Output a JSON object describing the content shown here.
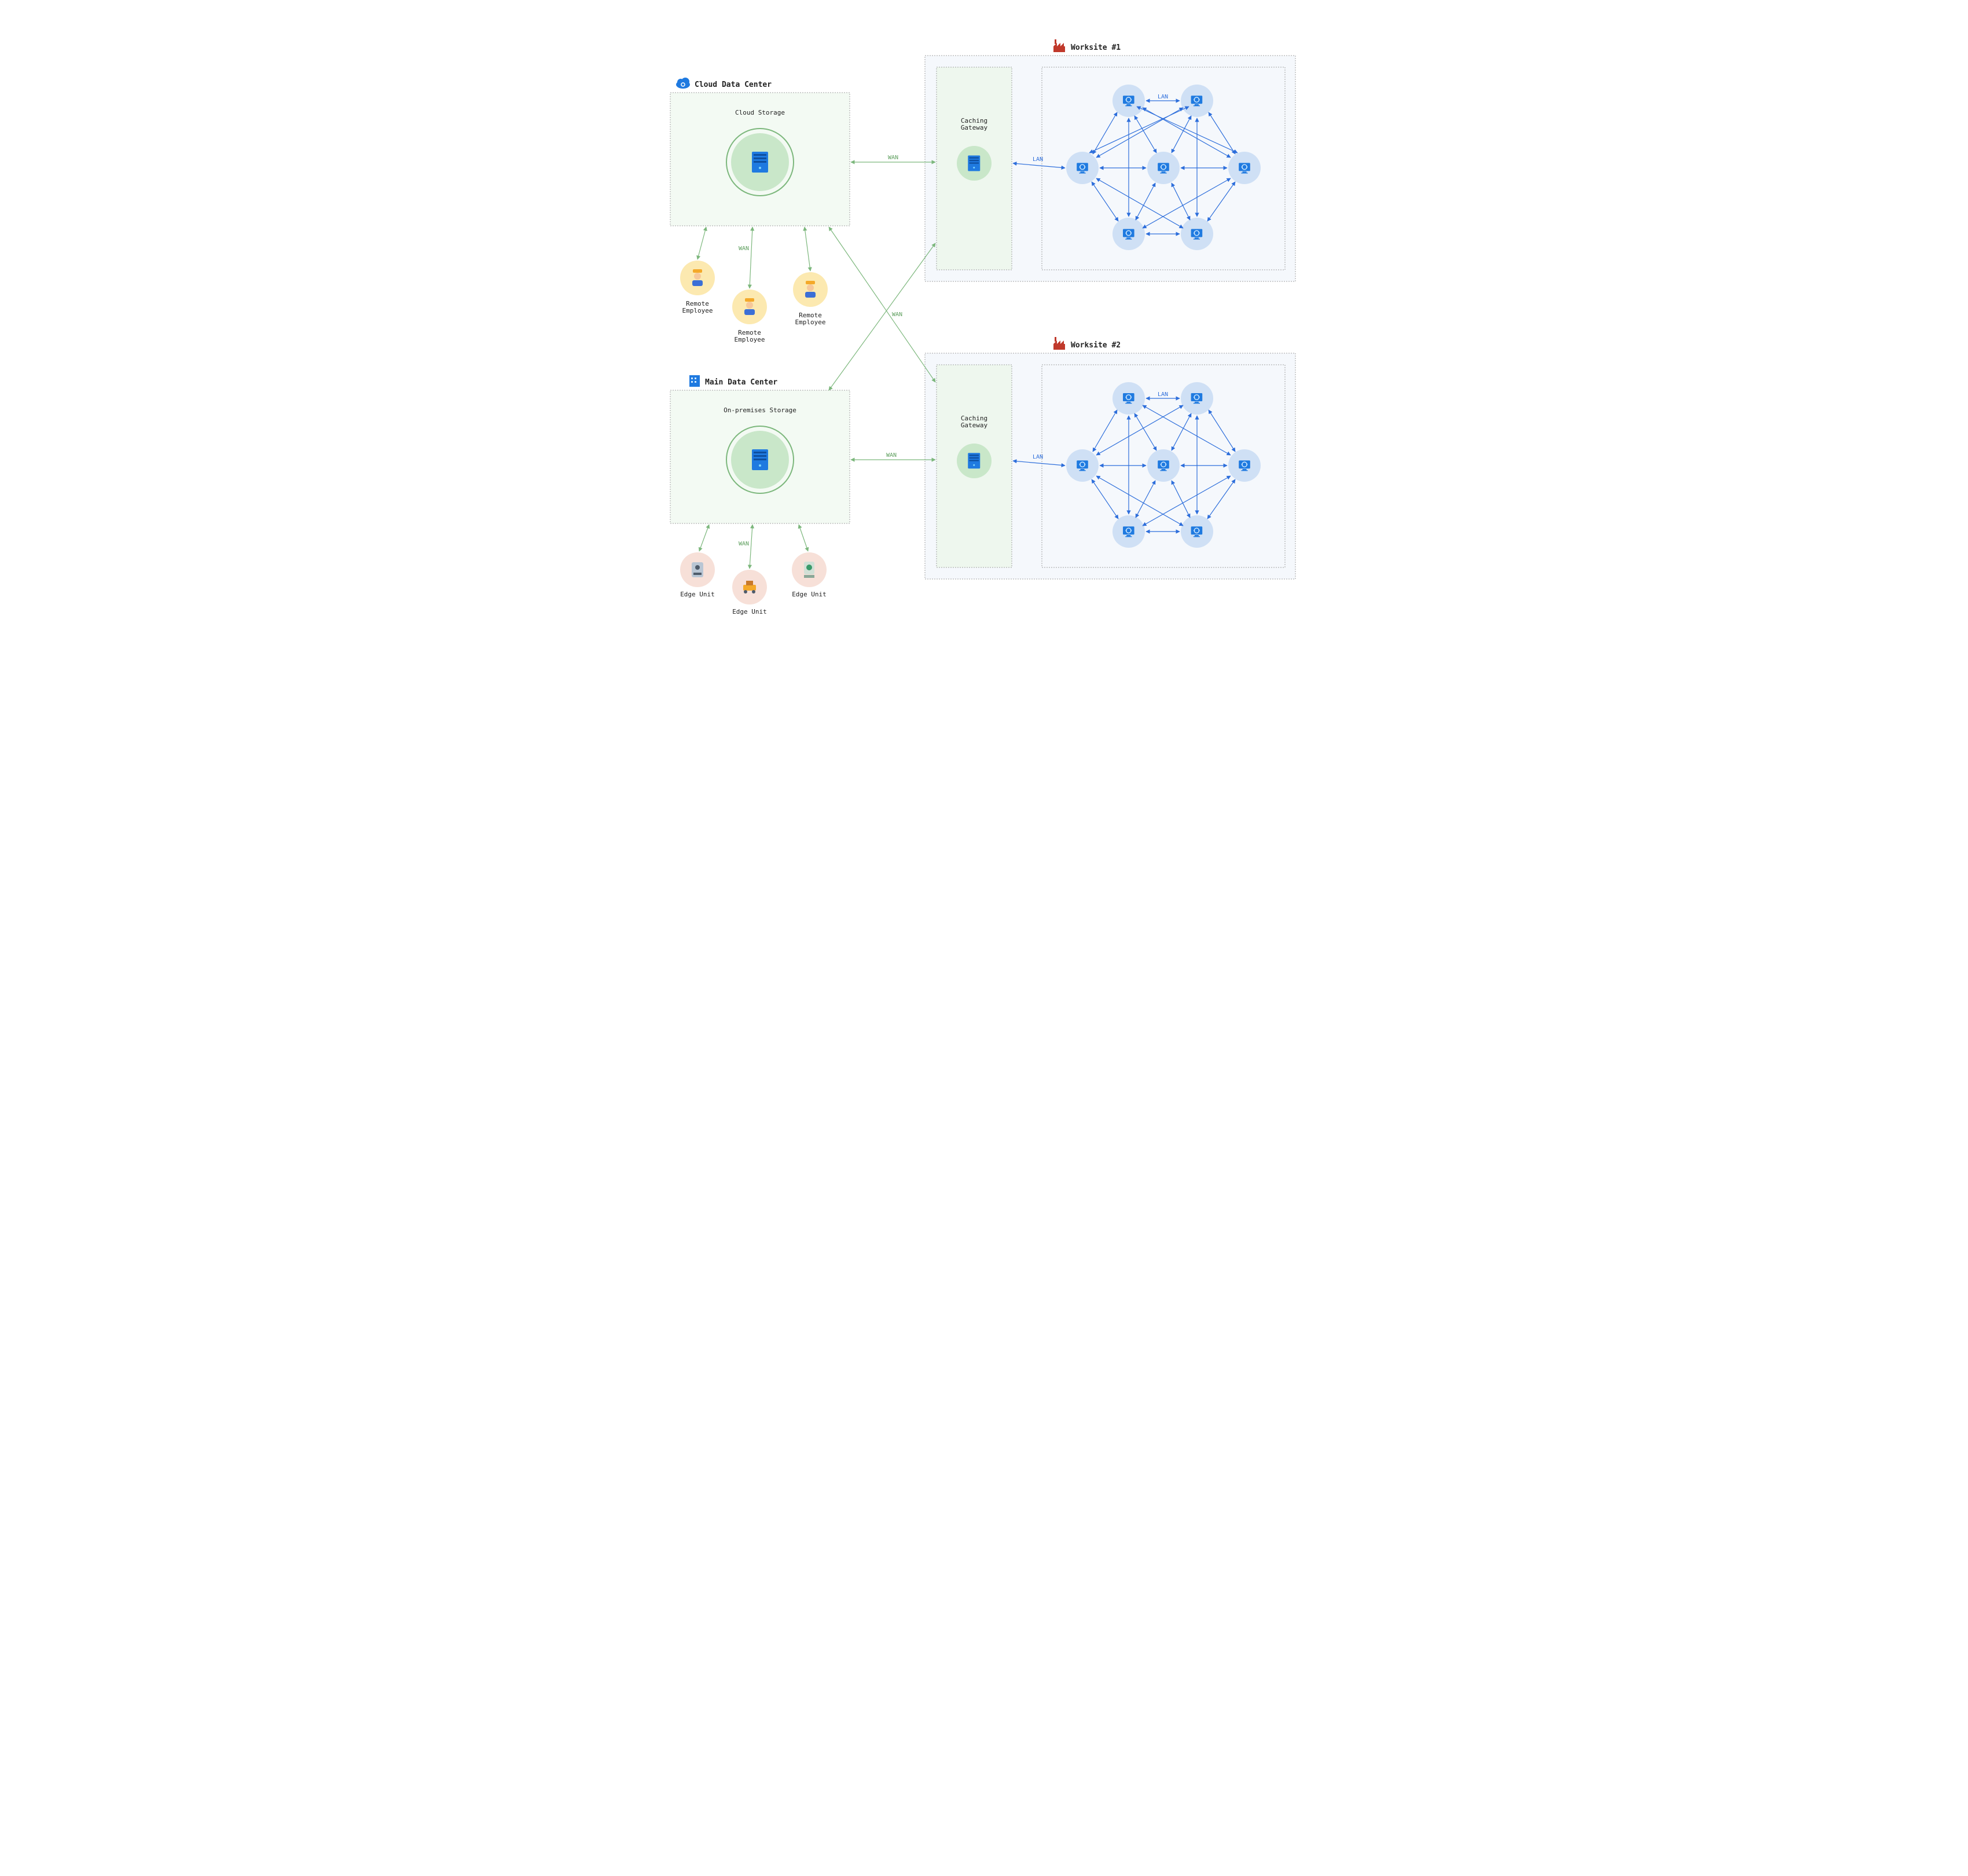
{
  "cloud": {
    "title": "Cloud Data Center",
    "storage_label": "Cloud Storage"
  },
  "main": {
    "title": "Main Data Center",
    "storage_label": "On-premises Storage"
  },
  "employees": [
    "Remote\nEmployee",
    "Remote\nEmployee",
    "Remote\nEmployee"
  ],
  "edge_units": [
    "Edge Unit",
    "Edge Unit",
    "Edge Unit"
  ],
  "worksite1": {
    "title": "Worksite #1",
    "gateway_label": "Caching\nGateway",
    "lan_inner": "LAN"
  },
  "worksite2": {
    "title": "Worksite #2",
    "gateway_label": "Caching\nGateway",
    "lan_inner": "LAN"
  },
  "links": {
    "wan": "WAN",
    "lan": "LAN"
  },
  "colors": {
    "green": "#7cb77c",
    "blue": "#2d6edb",
    "yellow": "#fce9b0",
    "peach": "#f7e0d8",
    "nodeblue": "#cfe0f5",
    "storage_green": "#c9e7c9"
  }
}
